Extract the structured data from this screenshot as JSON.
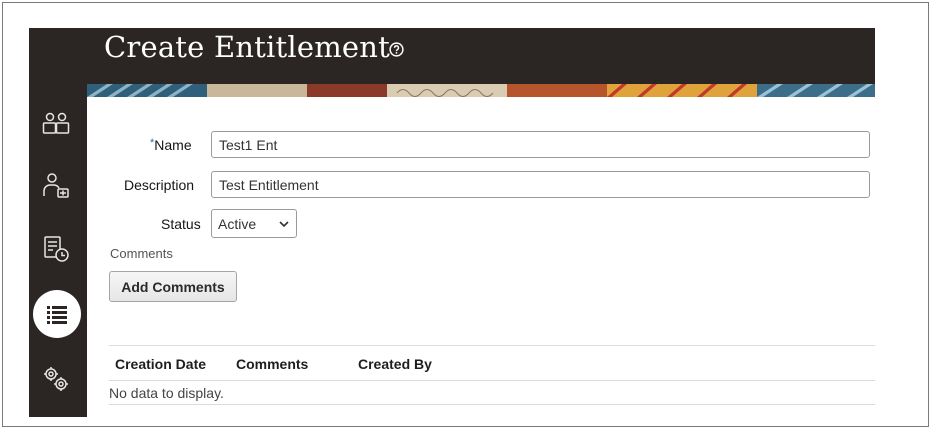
{
  "page": {
    "title": "Create Entitlement"
  },
  "form": {
    "name_label": "Name",
    "name_required_marker": "*",
    "name_value": "Test1 Ent",
    "description_label": "Description",
    "description_value": "Test Entitlement",
    "status_label": "Status",
    "status_value": "Active",
    "comments_label": "Comments",
    "add_comments_button": "Add Comments"
  },
  "table": {
    "columns": [
      "Creation Date",
      "Comments",
      "Created By"
    ],
    "empty_text": "No data to display."
  },
  "rail": {
    "icons": [
      "users-group-icon",
      "user-settings-icon",
      "document-clock-icon",
      "list-icon",
      "gears-icon"
    ],
    "active_index": 3
  },
  "colors": {
    "rail_bg": "#2b2623",
    "required_marker": "#1f6fb2"
  }
}
